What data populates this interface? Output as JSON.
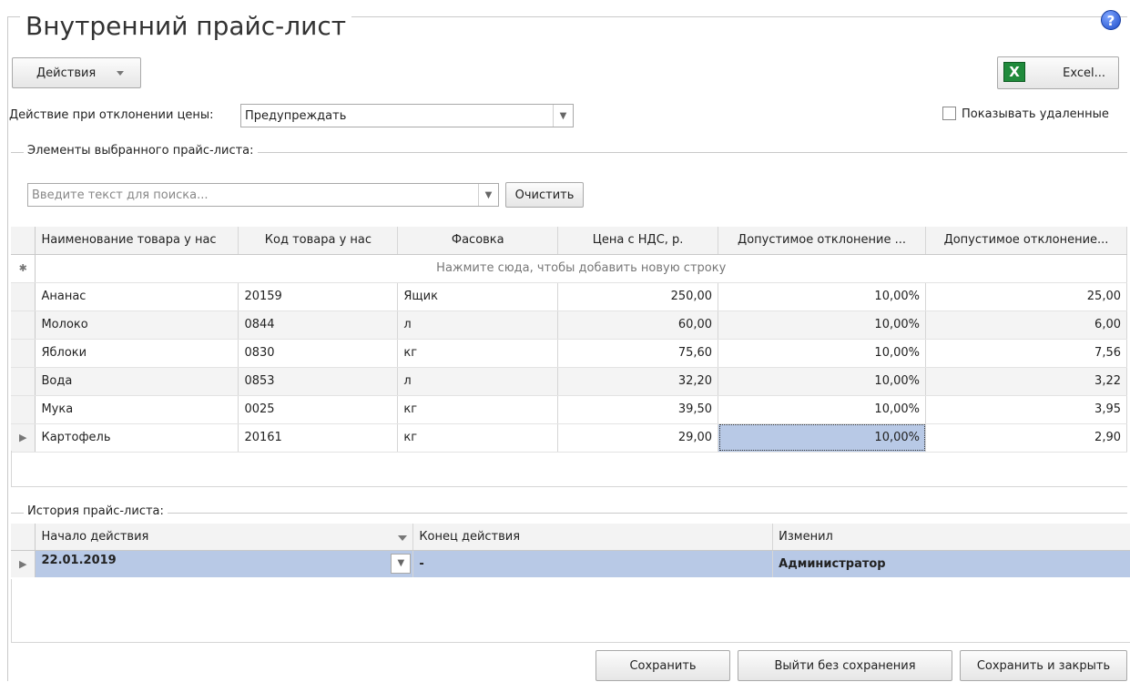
{
  "window": {
    "title": "Внутренний прайс-лист"
  },
  "toolbar": {
    "actions_label": "Действия",
    "excel_label": "Excel..."
  },
  "price_deviation": {
    "label": "Действие при отклонении цены:",
    "value": "Предупреждать"
  },
  "show_deleted": {
    "label": "Показывать удаленные",
    "checked": false
  },
  "items_section": {
    "label": "Элементы выбранного прайс-листа:",
    "search_placeholder": "Введите текст для поиска...",
    "clear_label": "Очистить",
    "columns": [
      "Наименование товара у нас",
      "Код товара у нас",
      "Фасовка",
      "Цена с НДС, р.",
      "Допустимое отклонение ...",
      "Допустимое отклонение..."
    ],
    "add_row_hint": "Нажмите сюда, чтобы добавить новую строку",
    "rows": [
      {
        "name": "Ананас",
        "code": "20159",
        "pack": "Ящик",
        "price": "250,00",
        "dev_pct": "10,00%",
        "dev_abs": "25,00"
      },
      {
        "name": "Молоко",
        "code": "0844",
        "pack": "л",
        "price": "60,00",
        "dev_pct": "10,00%",
        "dev_abs": "6,00"
      },
      {
        "name": "Яблоки",
        "code": "0830",
        "pack": "кг",
        "price": "75,60",
        "dev_pct": "10,00%",
        "dev_abs": "7,56"
      },
      {
        "name": "Вода",
        "code": "0853",
        "pack": "л",
        "price": "32,20",
        "dev_pct": "10,00%",
        "dev_abs": "3,22"
      },
      {
        "name": "Мука",
        "code": "0025",
        "pack": "кг",
        "price": "39,50",
        "dev_pct": "10,00%",
        "dev_abs": "3,95"
      },
      {
        "name": "Картофель",
        "code": "20161",
        "pack": "кг",
        "price": "29,00",
        "dev_pct": "10,00%",
        "dev_abs": "2,90"
      }
    ]
  },
  "history_section": {
    "label": "История прайс-листа:",
    "columns": [
      "Начало действия",
      "Конец действия",
      "Изменил"
    ],
    "rows": [
      {
        "start": "22.01.2019",
        "end": "-",
        "changed_by": "Администратор"
      }
    ]
  },
  "footer": {
    "save_label": "Сохранить",
    "exit_label": "Выйти без сохранения",
    "save_close_label": "Сохранить и закрыть"
  }
}
